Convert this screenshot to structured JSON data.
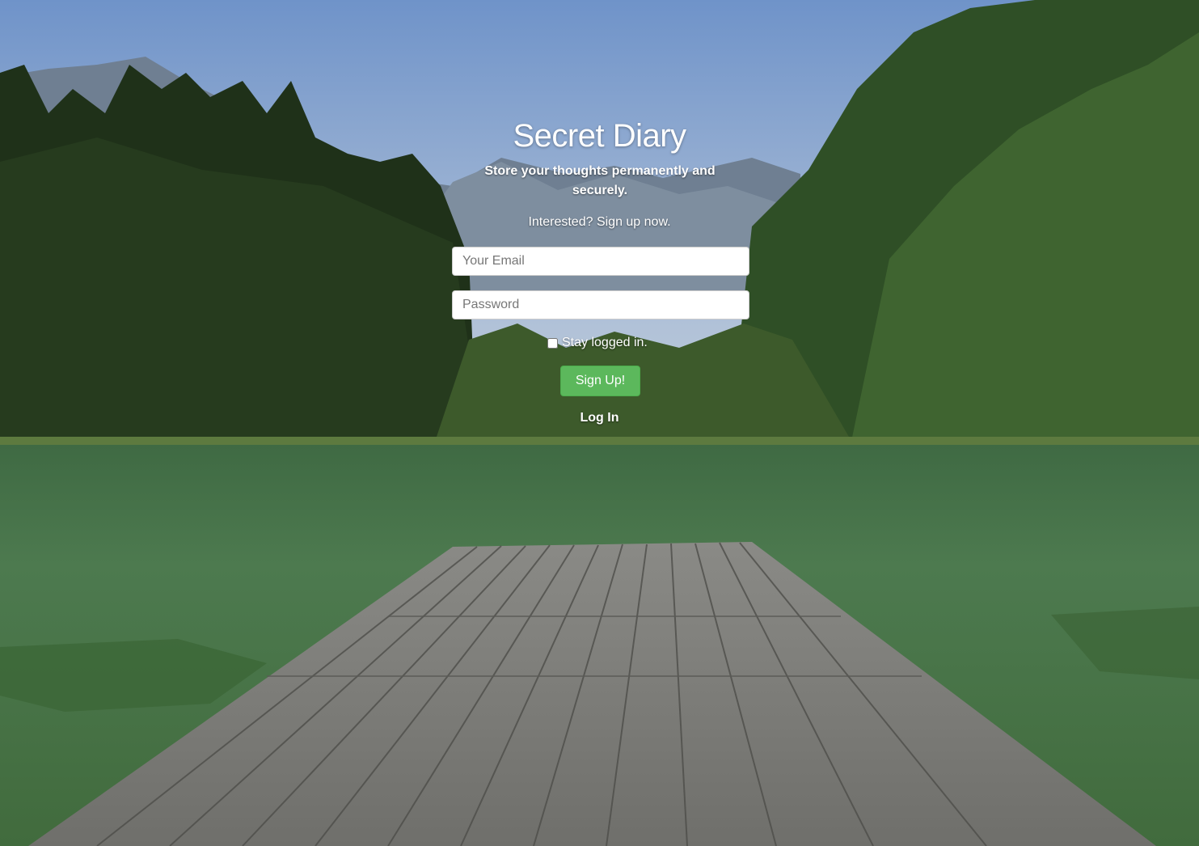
{
  "page": {
    "title": "Secret Diary",
    "tagline": "Store your thoughts permanently and securely.",
    "cta": "Interested? Sign up now."
  },
  "form": {
    "email_placeholder": "Your Email",
    "email_value": "",
    "password_placeholder": "Password",
    "password_value": "",
    "remember_label": "Stay logged in.",
    "remember_checked": false,
    "submit_label": "Sign Up!",
    "toggle_link": "Log In"
  },
  "colors": {
    "primary_button": "#5cb85c",
    "text": "#ffffff"
  },
  "background": {
    "description_icon": "landscape-photo"
  }
}
